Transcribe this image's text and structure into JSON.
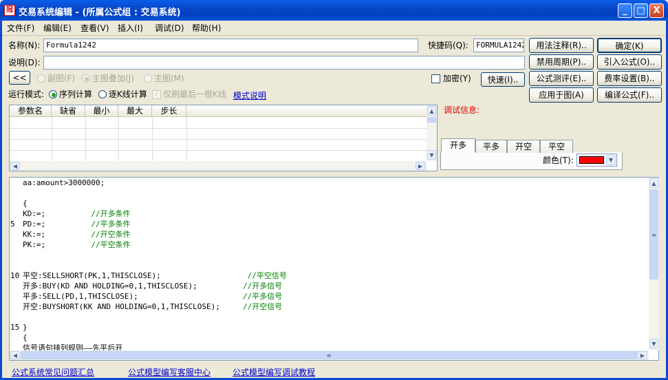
{
  "window": {
    "title": "交易系统编辑 - (所属公式组 : 交易系统)",
    "app_icon": "冠",
    "minimize": "_",
    "maximize": "□",
    "close": "X"
  },
  "menu": [
    "文件(F)",
    "编辑(E)",
    "查看(V)",
    "插入(I)",
    "调试(D)",
    "帮助(H)"
  ],
  "form": {
    "name_label": "名称(N):",
    "name_value": "Formula1242",
    "shortcut_label": "快捷码(Q):",
    "shortcut_value": "FORMULA1242",
    "desc_label": "说明(D):",
    "desc_value": ""
  },
  "chart_mode": {
    "collapse": "<<",
    "sub": "副图(F)",
    "overlay": "主图叠加(J)",
    "main": "主图(M)"
  },
  "encrypt_label": "加密(Y)",
  "run_mode": {
    "label": "运行模式:",
    "sequence": "序列计算",
    "per_bar": "逐K线计算",
    "refresh_last": "仅刷最后一根K线",
    "help_link": "模式说明"
  },
  "buttons": {
    "usage_note": "用法注释(R)..",
    "ok": "确定(K)",
    "disable_period": "禁用周期(P)..",
    "import": "引入公式(O)..",
    "evaluate": "公式测评(E)..",
    "fee_settings": "费率设置(B)..",
    "fast": "快速(I)..",
    "apply": "应用于图(A)",
    "compile": "编译公式(F)..",
    "debug_info": "调试信息:"
  },
  "param_table": {
    "headers": [
      "参数名",
      "缺省",
      "最小",
      "最大",
      "步长"
    ]
  },
  "signal_tabs": [
    "开多",
    "平多",
    "开空",
    "平空"
  ],
  "color_label": "颜色(T):",
  "colors": {
    "signal": "#ff0000",
    "accent": "#0a47c9"
  },
  "code_lines": [
    {
      "num": "",
      "text": "aa:amount>3000000;"
    },
    {
      "num": "",
      "text": ""
    },
    {
      "num": "",
      "text": "{"
    },
    {
      "num": "",
      "text": "KD:=;          //开多条件"
    },
    {
      "num": "5",
      "text": "PD:=;          //平多条件"
    },
    {
      "num": "",
      "text": "KK:=;          //开空条件"
    },
    {
      "num": "",
      "text": "PK:=;          //平空条件"
    },
    {
      "num": "",
      "text": ""
    },
    {
      "num": "",
      "text": ""
    },
    {
      "num": "10",
      "text": "平空:SELLSHORT(PK,1,THISCLOSE);                   //平空信号"
    },
    {
      "num": "",
      "text": "开多:BUY(KD AND HOLDING=0,1,THISCLOSE);          //开多信号"
    },
    {
      "num": "",
      "text": "平多:SELL(PD,1,THISCLOSE);                       //平多信号"
    },
    {
      "num": "",
      "text": "开空:BUYSHORT(KK AND HOLDING=0,1,THISCLOSE);     //开空信号"
    },
    {
      "num": "",
      "text": ""
    },
    {
      "num": "15",
      "text": "}"
    },
    {
      "num": "",
      "text": "{"
    },
    {
      "num": "",
      "text": "信号语句排列规则——先平后开"
    }
  ],
  "footer_links": [
    "公式系统常见问题汇总",
    "公式模型编写客服中心",
    "公式模型编写调试教程"
  ]
}
